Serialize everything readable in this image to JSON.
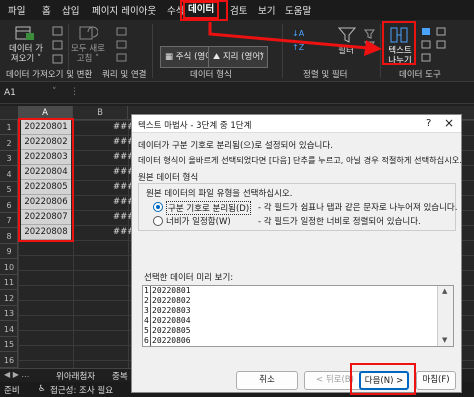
{
  "ribbon_tabs": [
    "파일",
    "홈",
    "삽입",
    "페이지 레이아웃",
    "수식",
    "데이터",
    "검토",
    "보기",
    "도움말"
  ],
  "ribbon": {
    "get_data": "데이터 가\n져오기 ˅",
    "refresh_all": "모두 새로\n고침 ˅",
    "type_stock": "주식 (영어)",
    "type_geo": "지리 (영어)",
    "filter": "필터",
    "text_to_columns": "텍스트\n나누기",
    "groups": [
      "데이터 가져오기 및 변환",
      "쿼리 및 연결",
      "데이터 형식",
      "정렬 및 필터",
      "데이터 도구"
    ]
  },
  "namebox": "A1",
  "columns": [
    "A",
    "B"
  ],
  "rows": [
    "1",
    "2",
    "3",
    "4",
    "5",
    "6",
    "7",
    "8",
    "9",
    "10",
    "11",
    "12",
    "13",
    "14",
    "15",
    "16"
  ],
  "column_a_values": [
    "20220801",
    "20220802",
    "20220803",
    "20220804",
    "20220805",
    "20220806",
    "20220807",
    "20220808"
  ],
  "column_b_hash": "###",
  "sheet_tabs": [
    "위아래첨자",
    "중복"
  ],
  "status": {
    "ready": "준비",
    "accessibility": "접근성: 조사 필요"
  },
  "dialog": {
    "title": "텍스트 마법사 - 3단계 중 1단계",
    "help": "?",
    "close": "×",
    "line1": "데이터가 구분 기호로 분리됨(으)로 설정되어 있습니다.",
    "line2": "데이터 형식이 올바르게 선택되었다면 [다음] 단추를 누르고, 아닐 경우 적절하게 선택하십시오.",
    "section": "원본 데이터 형식",
    "prompt": "원본 데이터의 파일 유형을 선택하십시오.",
    "radio1_label": "구분 기호로 분리됨(D)",
    "radio1_desc": "- 각 필드가 쉼표나 탭과 같은 문자로 나누어져 있습니다.",
    "radio2_label": "너비가 일정함(W)",
    "radio2_desc": "- 각 필드가 일정한 너비로 정렬되어 있습니다.",
    "preview_label": "선택한 데이터 미리 보기:",
    "preview_rows": [
      "20220801",
      "20220802",
      "20220803",
      "20220804",
      "20220805",
      "20220806"
    ],
    "cancel": "취소",
    "back": "< 뒤로(B)",
    "next": "다음(N) >",
    "finish": "마침(F)"
  },
  "colors": {
    "highlight": "#e11111",
    "dark_bg": "#1f1f1f",
    "dialog_bg": "#f0f0f0",
    "selected_cells": "#d3d3d3"
  }
}
